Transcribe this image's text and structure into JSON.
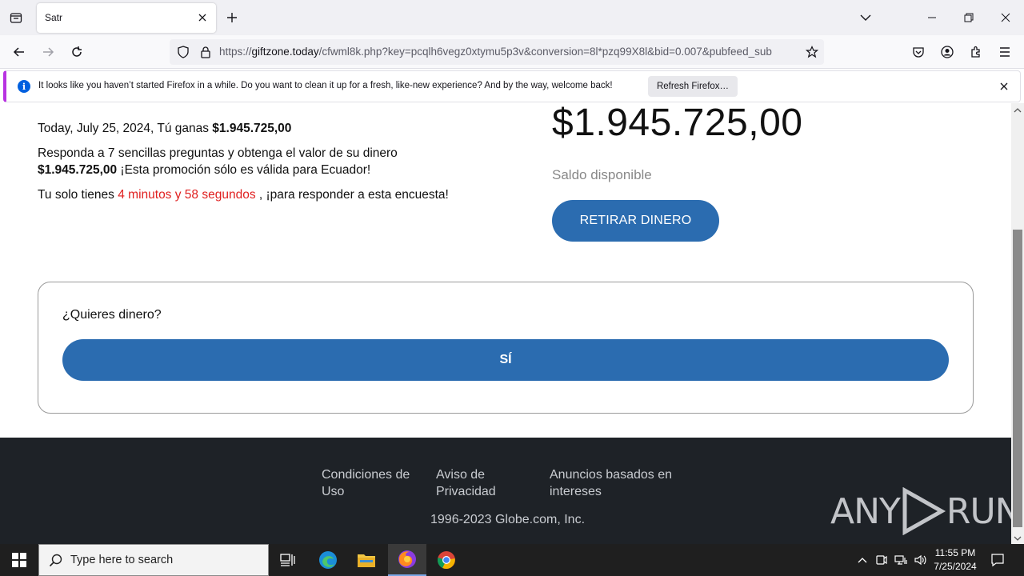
{
  "browser": {
    "tab_title": "Satr",
    "url_prefix": "https://",
    "url_domain": "giftzone.today",
    "url_path": "/cfwml8k.php?key=pcqlh6vegz0xtymu5p3v&conversion=8l*pzq99X8l&bid=0.007&pubfeed_sub",
    "notification_text": "It looks like you haven’t started Firefox in a while. Do you want to clean it up for a fresh, like-new experience? And by the way, welcome back!",
    "notification_button": "Refresh Firefox…"
  },
  "page": {
    "date_line_prefix": "Today, July 25, 2024, Tú ganas ",
    "amount": "$1.945.725,00",
    "survey_line1": "Responda a 7 sencillas preguntas y obtenga el valor de su dinero",
    "survey_line2_amount": "$1.945.725,00",
    "survey_line2_rest": " ¡Esta promoción sólo es válida para Ecuador!",
    "timer_prefix": "Tu solo tienes ",
    "timer_value": "4 minutos y 58 segundos",
    "timer_suffix": " , ¡para responder a esta encuesta!",
    "big_amount": "$1.945.725,00",
    "balance_label": "Saldo disponible",
    "withdraw_button": "RETIRAR DINERO",
    "question": "¿Quieres dinero?",
    "yes_button": "SÍ"
  },
  "footer": {
    "terms_l1": "Condiciones de",
    "terms_l2": "Uso",
    "privacy_l1": "Aviso de",
    "privacy_l2": "Privacidad",
    "ads_l1": "Anuncios basados en",
    "ads_l2": "intereses",
    "copyright": "1996-2023 Globe.com, Inc."
  },
  "watermark": {
    "left": "ANY",
    "right": "RUN"
  },
  "taskbar": {
    "search_placeholder": "Type here to search",
    "time": "11:55 PM",
    "date": "7/25/2024"
  },
  "colors": {
    "accent_blue": "#2b6cb0",
    "timer_red": "#e02020",
    "footer_bg": "#1e2227",
    "notification_accent": "#b833e1"
  }
}
